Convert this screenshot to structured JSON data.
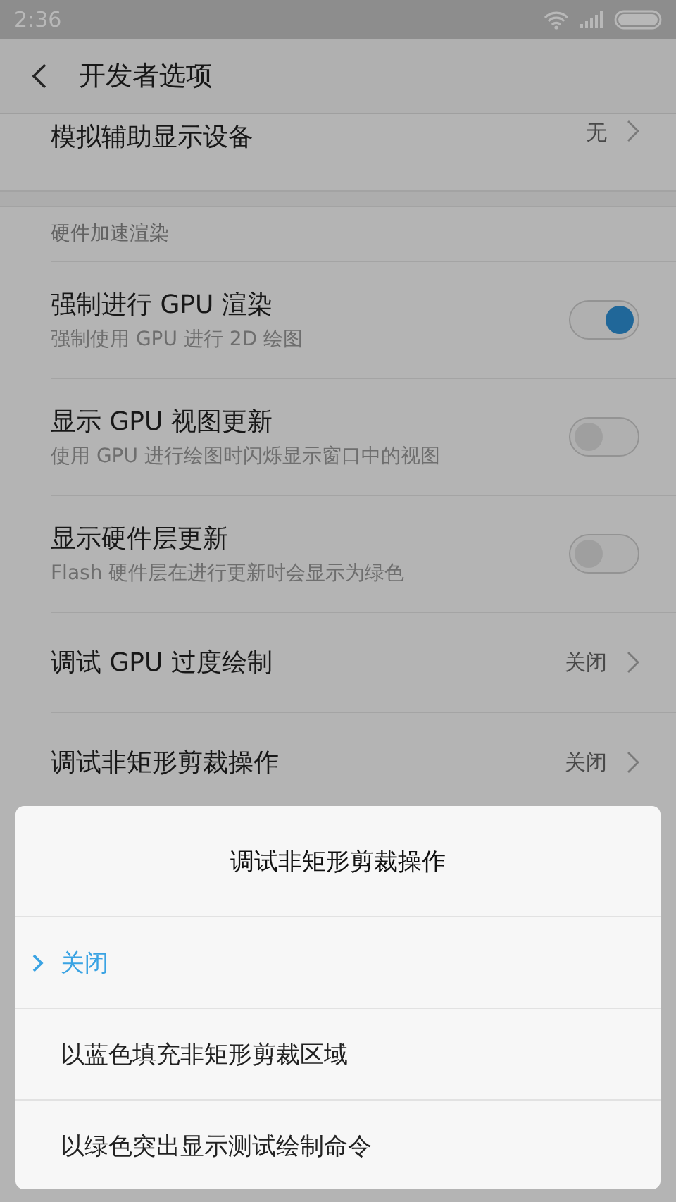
{
  "status_bar": {
    "time": "2:36"
  },
  "header": {
    "title": "开发者选项"
  },
  "top_row": {
    "label": "模拟辅助显示设备",
    "value": "无"
  },
  "section": {
    "title": "硬件加速渲染"
  },
  "rows": [
    {
      "kind": "toggle",
      "label": "强制进行 GPU 渲染",
      "subtitle": "强制使用 GPU 进行 2D 绘图",
      "on": true
    },
    {
      "kind": "toggle",
      "label": "显示 GPU 视图更新",
      "subtitle": "使用 GPU 进行绘图时闪烁显示窗口中的视图",
      "on": false
    },
    {
      "kind": "toggle",
      "label": "显示硬件层更新",
      "subtitle": "Flash 硬件层在进行更新时会显示为绿色",
      "on": false
    },
    {
      "kind": "link",
      "label": "调试 GPU 过度绘制",
      "value": "关闭"
    },
    {
      "kind": "link",
      "label": "调试非矩形剪裁操作",
      "value": "关闭"
    }
  ],
  "dialog": {
    "title": "调试非矩形剪裁操作",
    "options": [
      {
        "label": "关闭",
        "selected": true
      },
      {
        "label": "以蓝色填充非矩形剪裁区域",
        "selected": false
      },
      {
        "label": "以绿色突出显示测试绘制命令",
        "selected": false
      }
    ]
  }
}
